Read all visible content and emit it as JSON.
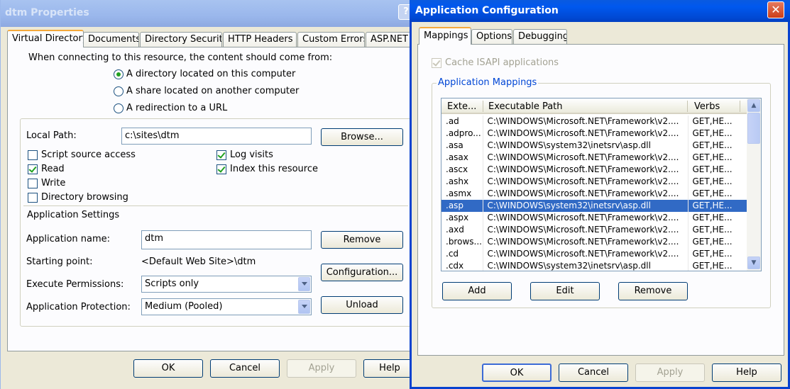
{
  "left": {
    "title": "dtm Properties",
    "tabs": [
      "Virtual Directory",
      "Documents",
      "Directory Security",
      "HTTP Headers",
      "Custom Errors",
      "ASP.NET"
    ],
    "connect_label": "When connecting to this resource, the content should come from:",
    "radios": [
      "A directory located on this computer",
      "A share located on another computer",
      "A redirection to a URL"
    ],
    "local_path_label": "Local Path:",
    "local_path_value": "c:\\sites\\dtm",
    "browse": "Browse...",
    "checks_left": [
      {
        "label": "Script source access",
        "checked": false
      },
      {
        "label": "Read",
        "checked": true
      },
      {
        "label": "Write",
        "checked": false
      },
      {
        "label": "Directory browsing",
        "checked": false
      }
    ],
    "checks_right": [
      {
        "label": "Log visits",
        "checked": true
      },
      {
        "label": "Index this resource",
        "checked": true
      }
    ],
    "app_settings": "Application Settings",
    "app_name_label": "Application name:",
    "app_name_value": "dtm",
    "remove": "Remove",
    "starting_point_label": "Starting point:",
    "starting_point_value": "<Default Web Site>\\dtm",
    "configuration": "Configuration...",
    "exec_perm_label": "Execute Permissions:",
    "exec_perm_value": "Scripts only",
    "unload": "Unload",
    "app_prot_label": "Application Protection:",
    "app_prot_value": "Medium (Pooled)",
    "ok": "OK",
    "cancel": "Cancel",
    "apply": "Apply",
    "help": "Help"
  },
  "right": {
    "title": "Application Configuration",
    "tabs": [
      "Mappings",
      "Options",
      "Debugging"
    ],
    "cache_label": "Cache ISAPI applications",
    "group_title": "Application Mappings",
    "columns": [
      "Exte...",
      "Executable Path",
      "Verbs"
    ],
    "rows": [
      [
        ".ad",
        "C:\\WINDOWS\\Microsoft.NET\\Framework\\v2....",
        "GET,HE..."
      ],
      [
        ".adpro...",
        "C:\\WINDOWS\\Microsoft.NET\\Framework\\v2....",
        "GET,HE..."
      ],
      [
        ".asa",
        "C:\\WINDOWS\\system32\\inetsrv\\asp.dll",
        "GET,HE..."
      ],
      [
        ".asax",
        "C:\\WINDOWS\\Microsoft.NET\\Framework\\v2....",
        "GET,HE..."
      ],
      [
        ".ascx",
        "C:\\WINDOWS\\Microsoft.NET\\Framework\\v2....",
        "GET,HE..."
      ],
      [
        ".ashx",
        "C:\\WINDOWS\\Microsoft.NET\\Framework\\v2....",
        "GET,HE..."
      ],
      [
        ".asmx",
        "C:\\WINDOWS\\Microsoft.NET\\Framework\\v2....",
        "GET,HE..."
      ],
      [
        ".asp",
        "C:\\WINDOWS\\system32\\inetsrv\\asp.dll",
        "GET,HE..."
      ],
      [
        ".aspx",
        "C:\\WINDOWS\\Microsoft.NET\\Framework\\v2....",
        "GET,HE..."
      ],
      [
        ".axd",
        "C:\\WINDOWS\\Microsoft.NET\\Framework\\v2....",
        "GET,HE..."
      ],
      [
        ".brows...",
        "C:\\WINDOWS\\Microsoft.NET\\Framework\\v2....",
        "GET,HE..."
      ],
      [
        ".cd",
        "C:\\WINDOWS\\Microsoft.NET\\Framework\\v2....",
        "GET,HE..."
      ],
      [
        ".cdx",
        "C:\\WINDOWS\\system32\\inetsrv\\asp.dll",
        "GET,HE..."
      ]
    ],
    "selected_row": 7,
    "add": "Add",
    "edit": "Edit",
    "remove": "Remove",
    "ok": "OK",
    "cancel": "Cancel",
    "apply": "Apply",
    "help": "Help"
  },
  "colors": {
    "titlebar_active": "#0a5ae0",
    "titlebar_inactive": "#9db9eb",
    "dialog_bg": "#ece9d8",
    "selection": "#316ac5"
  }
}
